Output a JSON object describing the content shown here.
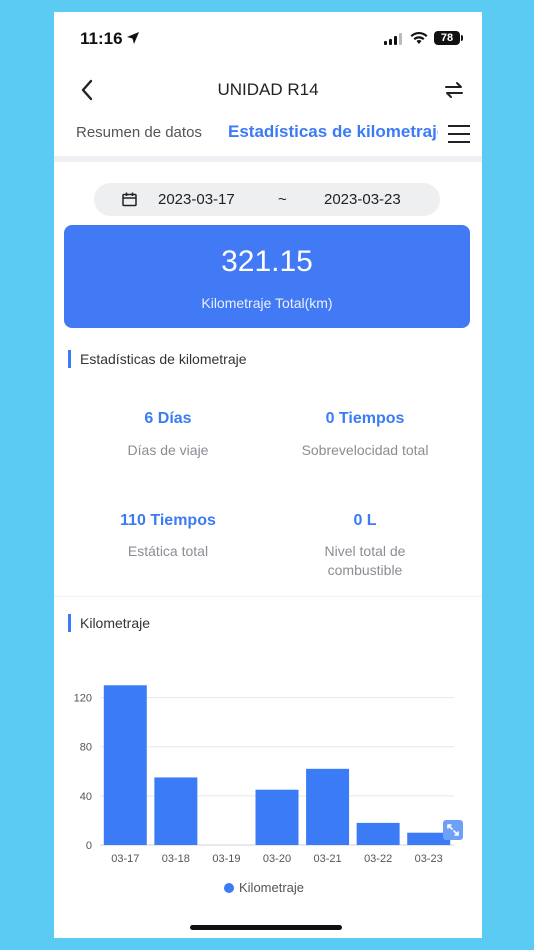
{
  "status": {
    "time": "11:16",
    "battery": "78"
  },
  "nav": {
    "title": "UNIDAD R14"
  },
  "tabs": [
    {
      "label": "Resumen de datos"
    },
    {
      "label": "Estadísticas de kilometraje"
    }
  ],
  "date_range": {
    "start": "2023-03-17",
    "separator": "~",
    "end": "2023-03-23"
  },
  "total": {
    "value": "321.15",
    "label": "Kilometraje Total(km)"
  },
  "stats_section": {
    "title": "Estadísticas de kilometraje",
    "items": [
      {
        "value": "6 Días",
        "label": "Días de viaje"
      },
      {
        "value": "0 Tiempos",
        "label": "Sobrevelocidad total"
      },
      {
        "value": "110 Tiempos",
        "label": "Estática total"
      },
      {
        "value": "0 L",
        "label": "Nivel total de combustible"
      }
    ]
  },
  "chart_section": {
    "title": "Kilometraje"
  },
  "chart_data": {
    "type": "bar",
    "categories": [
      "03-17",
      "03-18",
      "03-19",
      "03-20",
      "03-21",
      "03-22",
      "03-23"
    ],
    "series": [
      {
        "name": "Kilometraje",
        "values": [
          130,
          55,
          0,
          45,
          62,
          18,
          10
        ]
      }
    ],
    "yticks": [
      0,
      40,
      80,
      120
    ],
    "ylim": [
      0,
      140
    ],
    "grid": true,
    "legend": "bottom-center",
    "color": "#3b7bf6"
  },
  "colors": {
    "accent": "#3b7bf6",
    "card": "#4279f5",
    "background": "#5ccbf3"
  }
}
